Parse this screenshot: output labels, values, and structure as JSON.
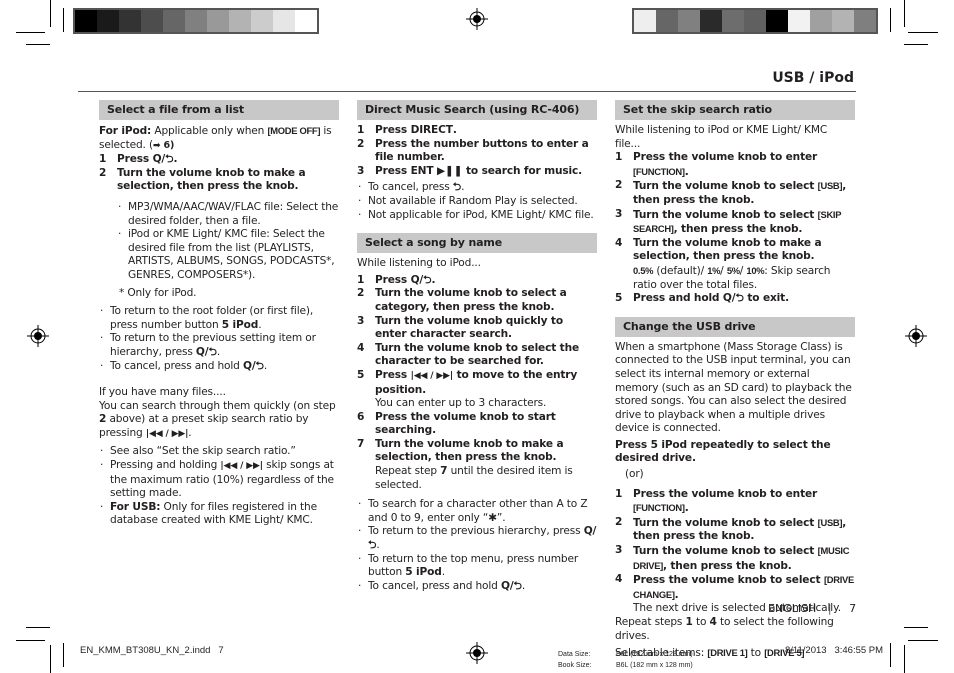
{
  "header": {
    "title": "USB / iPod"
  },
  "color_bars": {
    "left": [
      "#000000",
      "#1a1a1a",
      "#333333",
      "#4d4d4d",
      "#666666",
      "#808080",
      "#999999",
      "#b3b3b3",
      "#cccccc",
      "#e6e6e6",
      "#ffffff"
    ],
    "right": [
      "#eeeeee",
      "#666666",
      "#808080",
      "#2a2a2a",
      "#6d6d6d",
      "#606060",
      "#000000",
      "#f2f2f2",
      "#a0a0a0",
      "#b3b3b3",
      "#7f7f7f"
    ]
  },
  "icons": {
    "search_back": "Q/⮌",
    "back": "⮌",
    "prev_next": "|◀◀ / ▶▶|",
    "play_pause": "▶❚❚",
    "arrow": "➡",
    "asterisk": "✱"
  },
  "col1": {
    "heading": "Select a file from a list",
    "intro_bold": "For iPod:",
    "intro_a": " Applicable only when ",
    "intro_mode": "[MODE OFF]",
    "intro_b": " is selected. (",
    "intro_ref_arrow": "➡",
    "intro_ref": " 6)",
    "steps": [
      {
        "n": "1",
        "pre": "Press ",
        "icon": "Q/⮌",
        "post": "."
      },
      {
        "n": "2",
        "text": "Turn the volume knob to make a selection, then press the knob."
      }
    ],
    "sub_bullets": [
      "MP3/WMA/AAC/WAV/FLAC file: Select the desired folder, then a file.",
      "iPod or KME Light/ KMC file: Select the desired file from the list (PLAYLISTS, ARTISTS, ALBUMS, SONGS, PODCASTS*, GENRES, COMPOSERS*)."
    ],
    "footnote": "* Only for iPod.",
    "bullets": [
      {
        "pre": "To return to the root folder (or first file), press number button ",
        "bold": "5 iPod",
        "post": "."
      },
      {
        "pre": "To return to the previous setting item or hierarchy, press ",
        "icon": "Q/⮌",
        "post": "."
      },
      {
        "pre": "To cancel, press and hold ",
        "icon": "Q/⮌",
        "post": "."
      }
    ],
    "many_files_title": "If you have many files....",
    "many_files_a": "You can search through them quickly (on step ",
    "many_files_step": "2",
    "many_files_b": " above) at a preset skip search ratio by pressing ",
    "many_files_icon": "|◀◀ / ▶▶|",
    "many_files_c": ".",
    "bullets2": [
      {
        "text": "See also “Set the skip search ratio.”"
      },
      {
        "pre": "Pressing and holding ",
        "icon": "|◀◀ / ▶▶|",
        "post": " skip songs at the maximum ratio (10%) regardless of the setting made."
      },
      {
        "bold": "For USB:",
        "post": " Only for files registered in the database created with KME Light/ KMC."
      }
    ]
  },
  "col2": {
    "sec1": {
      "heading": "Direct Music Search (using RC-406)",
      "steps": [
        {
          "n": "1",
          "pre": "Press ",
          "bold": "DIRECT",
          "post": "."
        },
        {
          "n": "2",
          "text": "Press the number buttons to enter a file number."
        },
        {
          "n": "3",
          "pre": "Press ",
          "bold": "ENT ▶❚❚",
          "post": " to search for music."
        }
      ],
      "bullets": [
        {
          "pre": "To cancel, press ",
          "icon": "⮌",
          "post": "."
        },
        {
          "text": "Not available if Random Play is selected."
        },
        {
          "text": "Not applicable for iPod, KME Light/ KMC file."
        }
      ]
    },
    "sec2": {
      "heading": "Select a song by name",
      "intro": "While listening to iPod...",
      "steps": [
        {
          "n": "1",
          "pre": "Press ",
          "icon": "Q/⮌",
          "post": "."
        },
        {
          "n": "2",
          "text": "Turn the volume knob to select a category, then press the knob."
        },
        {
          "n": "3",
          "text": "Turn the volume knob quickly to enter character search."
        },
        {
          "n": "4",
          "text": "Turn the volume knob to select the character to be searched for."
        },
        {
          "n": "5",
          "pre": "Press ",
          "icon": "|◀◀ / ▶▶|",
          "post": " to move to the entry position.",
          "note": "You can enter up to 3 characters."
        },
        {
          "n": "6",
          "text": "Press the volume knob to start searching."
        },
        {
          "n": "7",
          "text": "Turn the volume knob to make a selection, then press the knob.",
          "note_a": "Repeat step ",
          "note_b": "7",
          "note_c": " until the desired item is selected."
        }
      ],
      "bullets": [
        {
          "pre": "To search for a character other than A to Z and 0 to 9, enter only “",
          "icon": "✱",
          "post": "”."
        },
        {
          "pre": "To return to the previous hierarchy, press ",
          "icon": "Q/⮌",
          "post": "."
        },
        {
          "pre": "To return to the top menu, press number button ",
          "bold": "5 iPod",
          "post": "."
        },
        {
          "pre": "To cancel, press and hold ",
          "icon": "Q/⮌",
          "post": "."
        }
      ]
    }
  },
  "col3": {
    "sec1": {
      "heading": "Set the skip search ratio",
      "intro": "While listening to iPod or KME Light/ KMC file...",
      "steps": [
        {
          "n": "1",
          "pre": "Press the volume knob to enter ",
          "tag": "[FUNCTION]",
          "post": "."
        },
        {
          "n": "2",
          "pre": "Turn the volume knob to select ",
          "tag": "[USB]",
          "post": ", then press the knob."
        },
        {
          "n": "3",
          "pre": "Turn the volume knob to select ",
          "tag": "[SKIP SEARCH]",
          "post": ", then press the knob."
        },
        {
          "n": "4",
          "text": "Turn the volume knob to make a selection, then press the knob.",
          "note_tag": "0.5%",
          "note_a": " (default)/ ",
          "note_tag2": "1%",
          "note_b": "/ ",
          "note_tag3": "5%",
          "note_c": "/ ",
          "note_tag4": "10%",
          "note_d": ": Skip search ratio over the total files."
        },
        {
          "n": "5",
          "pre": "Press and hold ",
          "icon": "Q/⮌",
          "post": " to exit."
        }
      ]
    },
    "sec2": {
      "heading": "Change the USB drive",
      "intro": "When a smartphone (Mass Storage Class) is connected to the USB input terminal, you can select its internal memory or external memory (such as an SD card) to playback the stored songs. You can also select the desired drive to playback when a multiple drives device is connected.",
      "press_a": "Press ",
      "press_b": "5 iPod",
      "press_c": " repeatedly to select the desired drive.",
      "or": "(or)",
      "steps": [
        {
          "n": "1",
          "pre": "Press the volume knob to enter ",
          "tag": "[FUNCTION]",
          "post": "."
        },
        {
          "n": "2",
          "pre": "Turn the volume knob to select ",
          "tag": "[USB]",
          "post": ", then press the knob."
        },
        {
          "n": "3",
          "pre": "Turn the volume knob to select ",
          "tag": "[MUSIC DRIVE]",
          "post": ", then press the knob."
        },
        {
          "n": "4",
          "pre": "Press the volume knob to select ",
          "tag": "[DRIVE CHANGE]",
          "post": ".",
          "note": "The next drive is selected automatically."
        }
      ],
      "repeat_a": "Repeat steps ",
      "repeat_b": "1",
      "repeat_c": " to ",
      "repeat_d": "4",
      "repeat_e": " to select the following drives.",
      "selectable_a": "Selectable items: ",
      "selectable_b": "[DRIVE 1]",
      "selectable_c": " to ",
      "selectable_d": "[DRIVE 5]"
    }
  },
  "footer": {
    "language": "ENGLISH",
    "separator": "|",
    "page": "7",
    "file": "EN_KMM_BT308U_KN_2.indd   7",
    "data_size_label": "Data Size:",
    "data_size_value": "B6L (182 mm x 128 mm)",
    "book_size_label": "Book Size:",
    "book_size_value": "B6L (182 mm x 128 mm)",
    "timestamp": "8/11/2013   3:46:55 PM"
  }
}
